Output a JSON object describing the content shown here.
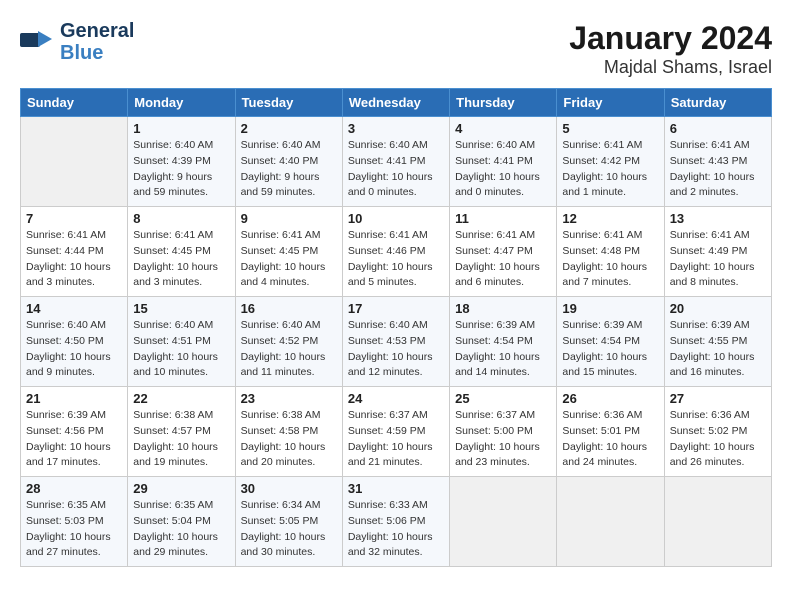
{
  "header": {
    "logo_line1": "General",
    "logo_line2": "Blue",
    "title": "January 2024",
    "subtitle": "Majdal Shams, Israel"
  },
  "days_of_week": [
    "Sunday",
    "Monday",
    "Tuesday",
    "Wednesday",
    "Thursday",
    "Friday",
    "Saturday"
  ],
  "weeks": [
    [
      {
        "day": "",
        "info": ""
      },
      {
        "day": "1",
        "info": "Sunrise: 6:40 AM\nSunset: 4:39 PM\nDaylight: 9 hours\nand 59 minutes."
      },
      {
        "day": "2",
        "info": "Sunrise: 6:40 AM\nSunset: 4:40 PM\nDaylight: 9 hours\nand 59 minutes."
      },
      {
        "day": "3",
        "info": "Sunrise: 6:40 AM\nSunset: 4:41 PM\nDaylight: 10 hours\nand 0 minutes."
      },
      {
        "day": "4",
        "info": "Sunrise: 6:40 AM\nSunset: 4:41 PM\nDaylight: 10 hours\nand 0 minutes."
      },
      {
        "day": "5",
        "info": "Sunrise: 6:41 AM\nSunset: 4:42 PM\nDaylight: 10 hours\nand 1 minute."
      },
      {
        "day": "6",
        "info": "Sunrise: 6:41 AM\nSunset: 4:43 PM\nDaylight: 10 hours\nand 2 minutes."
      }
    ],
    [
      {
        "day": "7",
        "info": "Sunrise: 6:41 AM\nSunset: 4:44 PM\nDaylight: 10 hours\nand 3 minutes."
      },
      {
        "day": "8",
        "info": "Sunrise: 6:41 AM\nSunset: 4:45 PM\nDaylight: 10 hours\nand 3 minutes."
      },
      {
        "day": "9",
        "info": "Sunrise: 6:41 AM\nSunset: 4:45 PM\nDaylight: 10 hours\nand 4 minutes."
      },
      {
        "day": "10",
        "info": "Sunrise: 6:41 AM\nSunset: 4:46 PM\nDaylight: 10 hours\nand 5 minutes."
      },
      {
        "day": "11",
        "info": "Sunrise: 6:41 AM\nSunset: 4:47 PM\nDaylight: 10 hours\nand 6 minutes."
      },
      {
        "day": "12",
        "info": "Sunrise: 6:41 AM\nSunset: 4:48 PM\nDaylight: 10 hours\nand 7 minutes."
      },
      {
        "day": "13",
        "info": "Sunrise: 6:41 AM\nSunset: 4:49 PM\nDaylight: 10 hours\nand 8 minutes."
      }
    ],
    [
      {
        "day": "14",
        "info": "Sunrise: 6:40 AM\nSunset: 4:50 PM\nDaylight: 10 hours\nand 9 minutes."
      },
      {
        "day": "15",
        "info": "Sunrise: 6:40 AM\nSunset: 4:51 PM\nDaylight: 10 hours\nand 10 minutes."
      },
      {
        "day": "16",
        "info": "Sunrise: 6:40 AM\nSunset: 4:52 PM\nDaylight: 10 hours\nand 11 minutes."
      },
      {
        "day": "17",
        "info": "Sunrise: 6:40 AM\nSunset: 4:53 PM\nDaylight: 10 hours\nand 12 minutes."
      },
      {
        "day": "18",
        "info": "Sunrise: 6:39 AM\nSunset: 4:54 PM\nDaylight: 10 hours\nand 14 minutes."
      },
      {
        "day": "19",
        "info": "Sunrise: 6:39 AM\nSunset: 4:54 PM\nDaylight: 10 hours\nand 15 minutes."
      },
      {
        "day": "20",
        "info": "Sunrise: 6:39 AM\nSunset: 4:55 PM\nDaylight: 10 hours\nand 16 minutes."
      }
    ],
    [
      {
        "day": "21",
        "info": "Sunrise: 6:39 AM\nSunset: 4:56 PM\nDaylight: 10 hours\nand 17 minutes."
      },
      {
        "day": "22",
        "info": "Sunrise: 6:38 AM\nSunset: 4:57 PM\nDaylight: 10 hours\nand 19 minutes."
      },
      {
        "day": "23",
        "info": "Sunrise: 6:38 AM\nSunset: 4:58 PM\nDaylight: 10 hours\nand 20 minutes."
      },
      {
        "day": "24",
        "info": "Sunrise: 6:37 AM\nSunset: 4:59 PM\nDaylight: 10 hours\nand 21 minutes."
      },
      {
        "day": "25",
        "info": "Sunrise: 6:37 AM\nSunset: 5:00 PM\nDaylight: 10 hours\nand 23 minutes."
      },
      {
        "day": "26",
        "info": "Sunrise: 6:36 AM\nSunset: 5:01 PM\nDaylight: 10 hours\nand 24 minutes."
      },
      {
        "day": "27",
        "info": "Sunrise: 6:36 AM\nSunset: 5:02 PM\nDaylight: 10 hours\nand 26 minutes."
      }
    ],
    [
      {
        "day": "28",
        "info": "Sunrise: 6:35 AM\nSunset: 5:03 PM\nDaylight: 10 hours\nand 27 minutes."
      },
      {
        "day": "29",
        "info": "Sunrise: 6:35 AM\nSunset: 5:04 PM\nDaylight: 10 hours\nand 29 minutes."
      },
      {
        "day": "30",
        "info": "Sunrise: 6:34 AM\nSunset: 5:05 PM\nDaylight: 10 hours\nand 30 minutes."
      },
      {
        "day": "31",
        "info": "Sunrise: 6:33 AM\nSunset: 5:06 PM\nDaylight: 10 hours\nand 32 minutes."
      },
      {
        "day": "",
        "info": ""
      },
      {
        "day": "",
        "info": ""
      },
      {
        "day": "",
        "info": ""
      }
    ]
  ]
}
